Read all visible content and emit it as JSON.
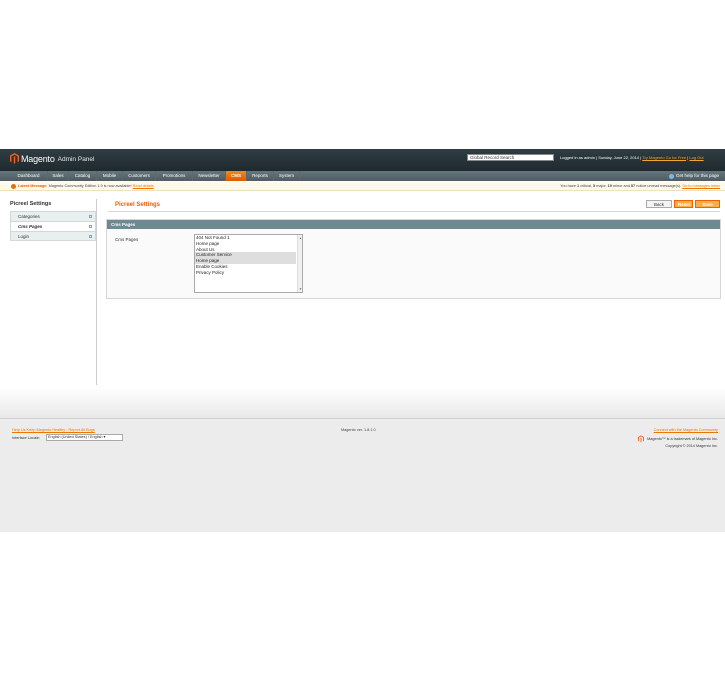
{
  "header": {
    "logo_text": "Magento",
    "logo_sub": "Admin Panel",
    "search_value": "Global Record Search",
    "logged_in": "Logged in as admin",
    "date": "Sunday, June 22, 2014",
    "try_link": "Try Magento Go for Free",
    "logout": "Log Out"
  },
  "nav": {
    "items": [
      "Dashboard",
      "Sales",
      "Catalog",
      "Mobile",
      "Customers",
      "Promotions",
      "Newsletter",
      "CMS",
      "Reports",
      "System"
    ],
    "active": "CMS",
    "help": "Get help for this page"
  },
  "notice": {
    "label": "Latest Message:",
    "text": "Magento Community Edition 1.9 is now available!",
    "link": "Read details",
    "right_prefix": "You have",
    "critical_count": "1",
    "critical_label": "critical",
    "major_count": "5",
    "major_label": "major",
    "minor_count": "19",
    "minor_label": "minor and",
    "notice_count": "57",
    "notice_label": "notice unread message(s).",
    "go_link": "Go to messages inbox"
  },
  "sidebar": {
    "title": "Picreel Settings",
    "items": [
      {
        "label": "Categories"
      },
      {
        "label": "Cms Pages"
      },
      {
        "label": "Login"
      }
    ]
  },
  "main": {
    "title": "Picreel Settings",
    "back_label": "Back",
    "reset_label": "Reset",
    "save_label": "Save",
    "fieldset_title": "Cms Pages",
    "field_label": "Cms Pages",
    "options": [
      "404 Not Found 1",
      "Home page",
      "About Us",
      "Customer Service",
      "Home page",
      "Enable Cookies",
      "Privacy Policy"
    ]
  },
  "footer": {
    "help_link": "Help Us Keep Magento Healthy - Report All Bugs",
    "locale_label": "Interface Locale:",
    "locale_value": "English (United States) / English",
    "version": "Magento ver. 1.8.1.0",
    "connect": "Connect with the Magento Community",
    "trademark": "Magento™ is a trademark of Magento Inc.",
    "copyright": "Copyright © 2014 Magento Inc."
  },
  "colors": {
    "accent": "#eb5e00",
    "header_bg": "#2f3d43",
    "nav_bg": "#5a696f",
    "fieldset_head": "#6f8992"
  }
}
